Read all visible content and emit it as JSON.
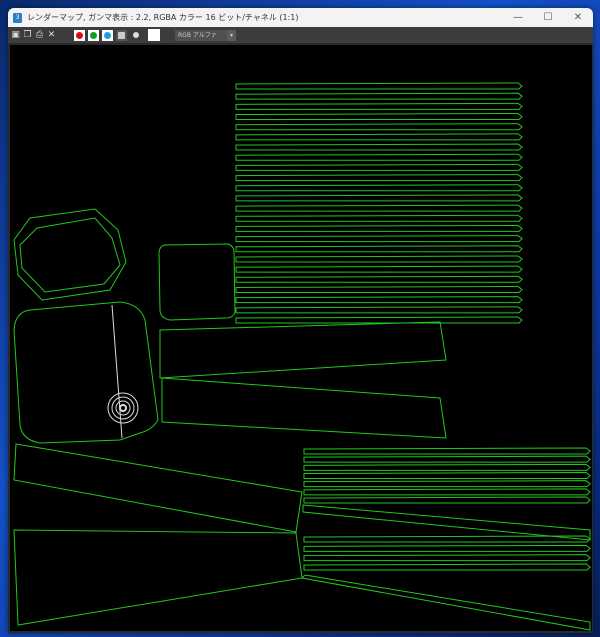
{
  "window": {
    "title": "レンダーマップ, ガンマ表示 : 2.2, RGBA カラー 16 ビット/チャネル (1:1)",
    "app_icon": "3ds-max-icon",
    "controls": {
      "minimize": "—",
      "maximize": "☐",
      "close": "✕"
    }
  },
  "toolbar": {
    "channel_select": "RGB アルファ",
    "colors": {
      "red": "#d01010",
      "green": "#10a020",
      "blue": "#1aa0e0",
      "mono": "#ffffff"
    }
  },
  "canvas": {
    "wire_color": "#22c81e",
    "background": "#000000"
  }
}
